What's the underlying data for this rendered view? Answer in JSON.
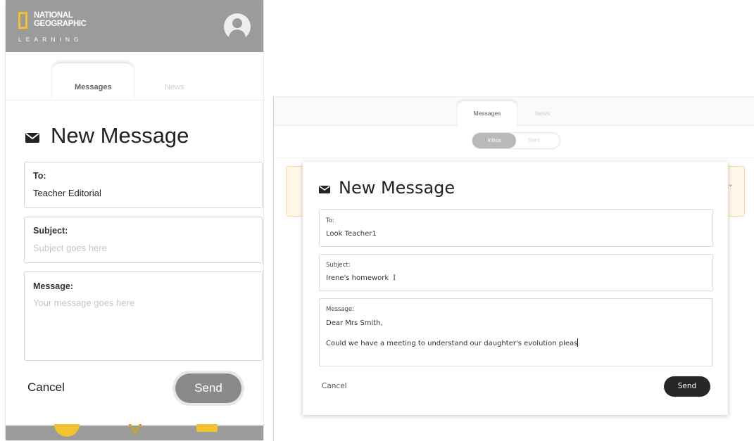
{
  "mobile": {
    "brand": {
      "line1": "NATIONAL",
      "line2": "GEOGRAPHIC",
      "sub": "LEARNING"
    },
    "tabs": [
      {
        "label": "Messages"
      },
      {
        "label": "News"
      }
    ],
    "compose": {
      "title": "New Message",
      "to_label": "To:",
      "to_value": "Teacher Editorial",
      "subject_label": "Subject:",
      "subject_placeholder": "Subject goes here",
      "message_label": "Message:",
      "message_placeholder": "Your message goes here",
      "cancel_label": "Cancel",
      "send_label": "Send"
    }
  },
  "desktop": {
    "tabs": [
      {
        "label": "Messages"
      },
      {
        "label": "News"
      }
    ],
    "toggle": {
      "inbox": "Inbox",
      "sent": "Sent"
    },
    "compose": {
      "title": "New Message",
      "to_label": "To:",
      "to_value": "Look Teacher1",
      "subject_label": "Subject:",
      "subject_value": "Irene's homework",
      "message_label": "Message:",
      "message_line1": "Dear Mrs Smith,",
      "message_line2": "Could we have a meeting to understand our daughter's evolution pleas",
      "cancel_label": "Cancel",
      "send_label": "Send"
    }
  },
  "colors": {
    "header_gray": "#9b9b9b",
    "logo_yellow": "#f2c230",
    "send_mobile": "#8a8a8a",
    "send_desktop": "#262626",
    "notification_bg": "#fff8e8"
  }
}
